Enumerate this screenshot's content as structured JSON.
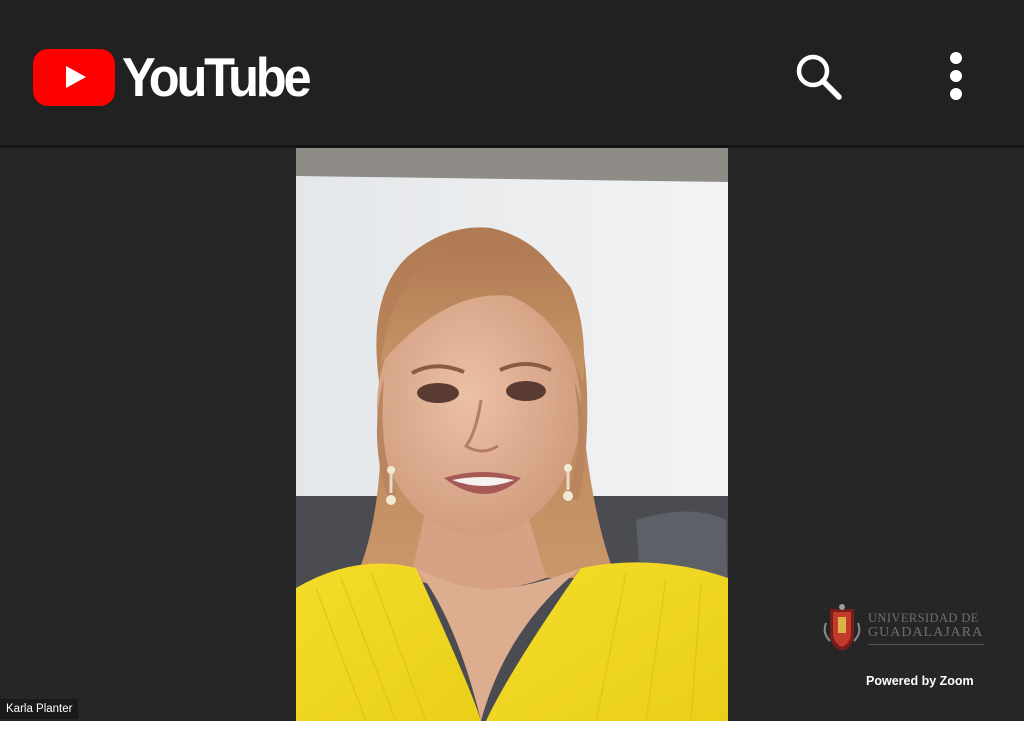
{
  "header": {
    "brand": "YouTube",
    "icons": {
      "logo": "youtube-play-icon",
      "search": "search-icon",
      "more": "more-vert-icon"
    }
  },
  "video": {
    "participant_name": "Karla Planter",
    "watermark": {
      "line1": "UNIVERSIDAD DE",
      "line2": "GUADALAJARA",
      "icon": "university-crest-icon"
    },
    "powered_by": "Powered by Zoom"
  },
  "colors": {
    "header_bg": "#212121",
    "stage_bg": "#262626",
    "brand_red": "#FF0000",
    "icon_white": "#FFFFFF",
    "shirt_yellow": "#F2D81F"
  }
}
